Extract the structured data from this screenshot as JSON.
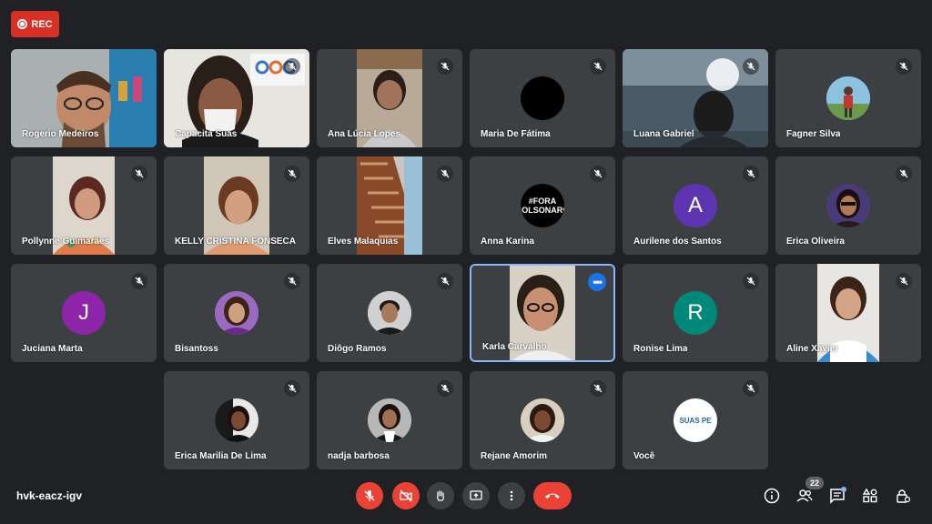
{
  "recording": {
    "label": "REC"
  },
  "meeting": {
    "code": "hvk-eacz-igv"
  },
  "participants_count": "22",
  "participants": [
    {
      "name": "Rogerio Medeiros"
    },
    {
      "name": "Capacita Suas"
    },
    {
      "name": "Ana Lúcia Lopes"
    },
    {
      "name": "Maria De Fátima"
    },
    {
      "name": "Luana Gabriel"
    },
    {
      "name": "Fagner Silva"
    },
    {
      "name": "Pollynne Guimarães"
    },
    {
      "name": "KELLY CRISTINA FONSECA"
    },
    {
      "name": "Elves Malaquias"
    },
    {
      "name": "Anna Karina",
      "avatar_text": "#FORA BOLSONARO"
    },
    {
      "name": "Aurilene dos Santos",
      "initial": "A",
      "color": "#5e35b1"
    },
    {
      "name": "Erica Oliveira"
    },
    {
      "name": "Juciana Marta",
      "initial": "J",
      "color": "#8e24aa"
    },
    {
      "name": "Bisantoss"
    },
    {
      "name": "Diôgo Ramos"
    },
    {
      "name": "Karla Carvalho"
    },
    {
      "name": "Ronise Lima",
      "initial": "R",
      "color": "#00897b"
    },
    {
      "name": "Aline Xavier"
    },
    {
      "name": "Erica Marilia De Lima"
    },
    {
      "name": "nadja barbosa"
    },
    {
      "name": "Rejane Amorim"
    },
    {
      "name": "Você",
      "avatar_text": "SUAS PE"
    }
  ],
  "controls": {
    "mic": "mic-off-icon",
    "camera": "camera-off-icon",
    "raise_hand": "hand-icon",
    "present": "present-icon",
    "more": "more-vert-icon",
    "hangup": "call-end-icon"
  },
  "colors": {
    "accent_red": "#ea4335",
    "active_border": "#8ab4f8",
    "tile": "#3c4043",
    "background": "#202124"
  }
}
